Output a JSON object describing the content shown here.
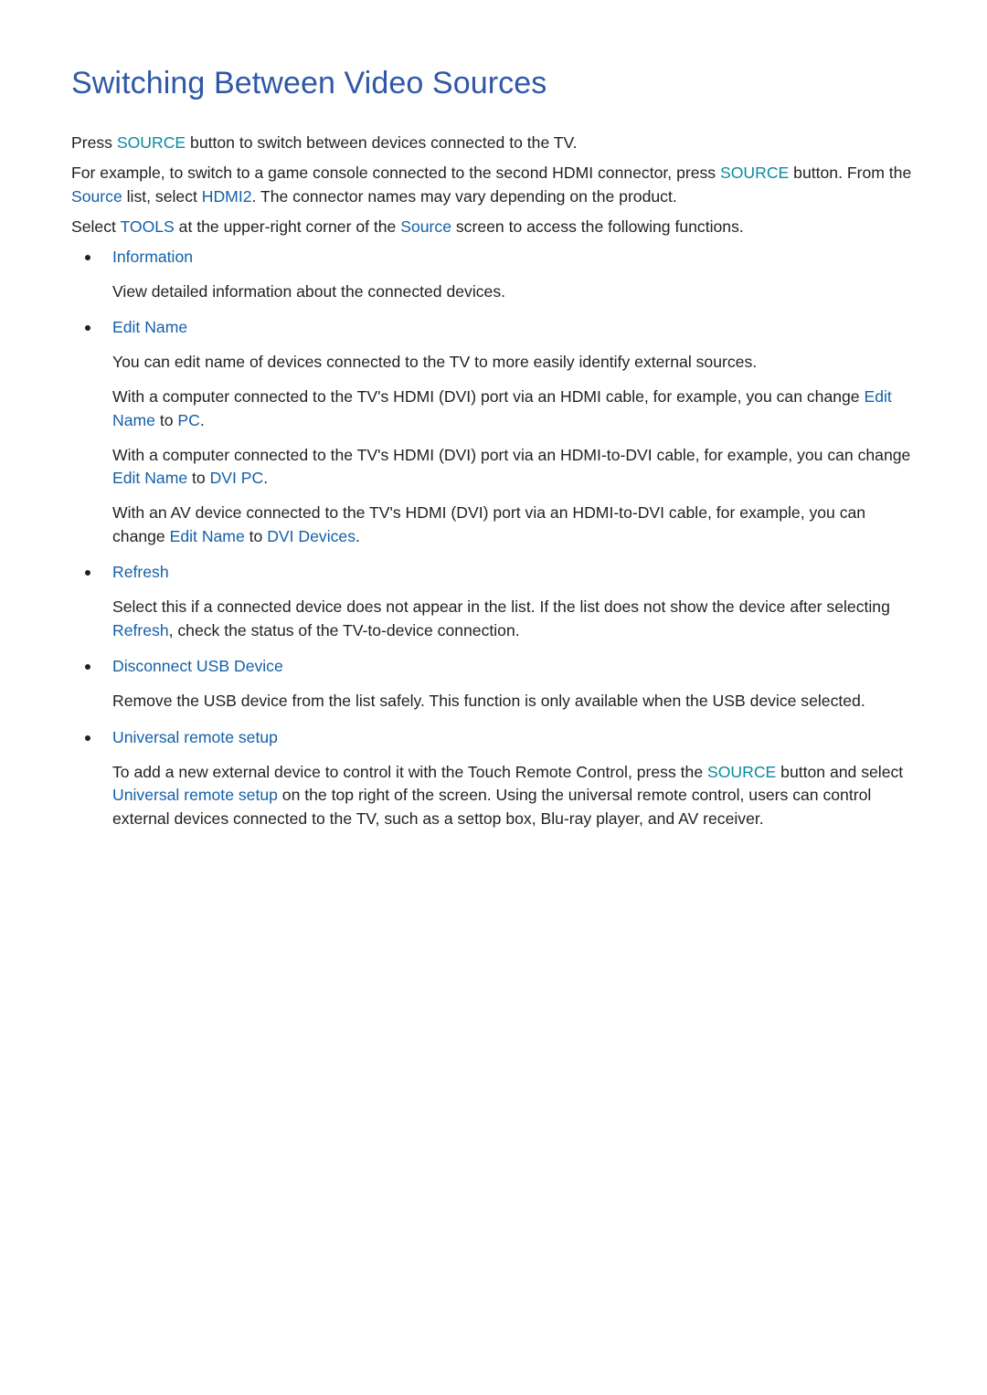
{
  "page": {
    "title": "Switching Between Video Sources",
    "colors": {
      "title": "#2f58a7",
      "source_button": "#0a8aa0",
      "menu_term": "#1460a8",
      "body_text": "#231f20"
    },
    "intro": [
      {
        "segments": [
          {
            "text": "Press ",
            "style": "plain"
          },
          {
            "text": "SOURCE",
            "style": "teal"
          },
          {
            "text": " button to switch between devices connected to the TV.",
            "style": "plain"
          }
        ]
      },
      {
        "segments": [
          {
            "text": "For example, to switch to a game console connected to the second HDMI connector, press ",
            "style": "plain"
          },
          {
            "text": "SOURCE",
            "style": "teal"
          },
          {
            "text": " button. From the ",
            "style": "plain"
          },
          {
            "text": "Source",
            "style": "blue"
          },
          {
            "text": " list, select ",
            "style": "plain"
          },
          {
            "text": "HDMI2",
            "style": "blue"
          },
          {
            "text": ". The connector names may vary depending on the product.",
            "style": "plain"
          }
        ]
      },
      {
        "segments": [
          {
            "text": "Select ",
            "style": "plain"
          },
          {
            "text": "TOOLS",
            "style": "blue"
          },
          {
            "text": " at the upper-right corner of the ",
            "style": "plain"
          },
          {
            "text": "Source",
            "style": "blue"
          },
          {
            "text": " screen to access the following functions.",
            "style": "plain"
          }
        ]
      }
    ],
    "features": [
      {
        "title": "Information",
        "paragraphs": [
          [
            {
              "text": "View detailed information about the connected devices.",
              "style": "plain"
            }
          ]
        ]
      },
      {
        "title": "Edit Name",
        "paragraphs": [
          [
            {
              "text": "You can edit name of devices connected to the TV to more easily identify external sources.",
              "style": "plain"
            }
          ],
          [
            {
              "text": "With a computer connected to the TV's HDMI (DVI) port via an HDMI cable, for example, you can change ",
              "style": "plain"
            },
            {
              "text": "Edit Name",
              "style": "blue"
            },
            {
              "text": " to ",
              "style": "plain"
            },
            {
              "text": "PC",
              "style": "blue"
            },
            {
              "text": ".",
              "style": "plain"
            }
          ],
          [
            {
              "text": "With a computer connected to the TV's HDMI (DVI) port via an HDMI-to-DVI cable, for example, you can change ",
              "style": "plain"
            },
            {
              "text": "Edit Name",
              "style": "blue"
            },
            {
              "text": " to ",
              "style": "plain"
            },
            {
              "text": "DVI PC",
              "style": "blue"
            },
            {
              "text": ".",
              "style": "plain"
            }
          ],
          [
            {
              "text": "With an AV device connected to the TV's HDMI (DVI) port via an HDMI-to-DVI cable, for example, you can change ",
              "style": "plain"
            },
            {
              "text": "Edit Name",
              "style": "blue"
            },
            {
              "text": " to ",
              "style": "plain"
            },
            {
              "text": "DVI Devices",
              "style": "blue"
            },
            {
              "text": ".",
              "style": "plain"
            }
          ]
        ]
      },
      {
        "title": "Refresh",
        "paragraphs": [
          [
            {
              "text": "Select this if a connected device does not appear in the list. If the list does not show the device after selecting ",
              "style": "plain"
            },
            {
              "text": "Refresh",
              "style": "blue"
            },
            {
              "text": ", check the status of the TV-to-device connection.",
              "style": "plain"
            }
          ]
        ]
      },
      {
        "title": "Disconnect USB Device",
        "paragraphs": [
          [
            {
              "text": "Remove the USB device from the list safely. This function is only available when the USB device selected.",
              "style": "plain"
            }
          ]
        ]
      },
      {
        "title": "Universal remote setup",
        "paragraphs": [
          [
            {
              "text": "To add a new external device to control it with the Touch Remote Control, press the ",
              "style": "plain"
            },
            {
              "text": "SOURCE",
              "style": "teal"
            },
            {
              "text": " button and select ",
              "style": "plain"
            },
            {
              "text": "Universal remote setup",
              "style": "blue"
            },
            {
              "text": " on the top right of the screen. Using the universal remote control, users can control external devices connected to the TV, such as a settop box, Blu-ray player, and AV receiver.",
              "style": "plain"
            }
          ]
        ]
      }
    ]
  }
}
